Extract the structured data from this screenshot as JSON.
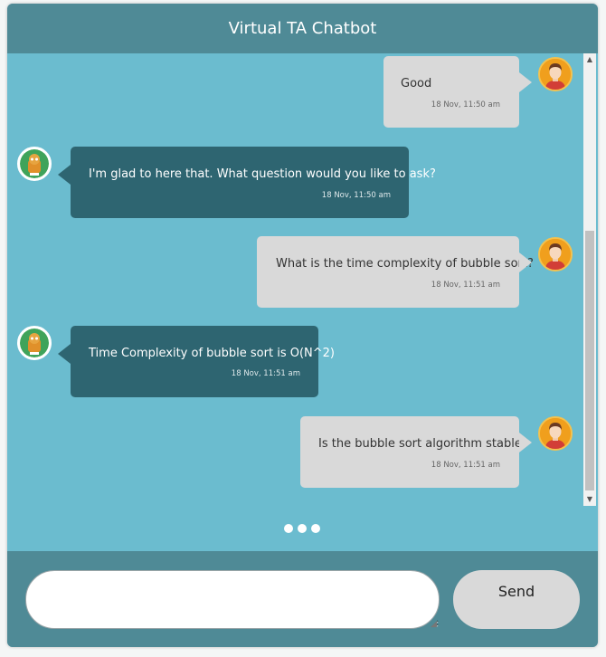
{
  "header": {
    "title": "Virtual TA Chatbot"
  },
  "messages": [
    {
      "sender": "user",
      "text": "Good",
      "time": "18 Nov, 11:50 am"
    },
    {
      "sender": "bot",
      "text": "I'm glad to here that. What question would you like to ask?",
      "time": "18 Nov, 11:50 am"
    },
    {
      "sender": "user",
      "text": "What is the time complexity of bubble sort?",
      "time": "18 Nov, 11:51 am"
    },
    {
      "sender": "bot",
      "text": "Time Complexity of bubble sort is O(N^2)",
      "time": "18 Nov, 11:51 am"
    },
    {
      "sender": "user",
      "text": "Is the bubble sort algorithm stable?",
      "time": "18 Nov, 11:51 am"
    }
  ],
  "composer": {
    "input_value": "",
    "send_label": "Send"
  },
  "colors": {
    "header": "#4f8a96",
    "chat_background": "#6bbccf",
    "user_bubble": "#d9d9d9",
    "bot_bubble": "#2e6571",
    "user_avatar": "#f09f1d"
  },
  "icons": {
    "user_avatar": "user-avatar-icon",
    "bot_avatar": "bot-avatar-icon",
    "typing": "typing-indicator-icon"
  }
}
